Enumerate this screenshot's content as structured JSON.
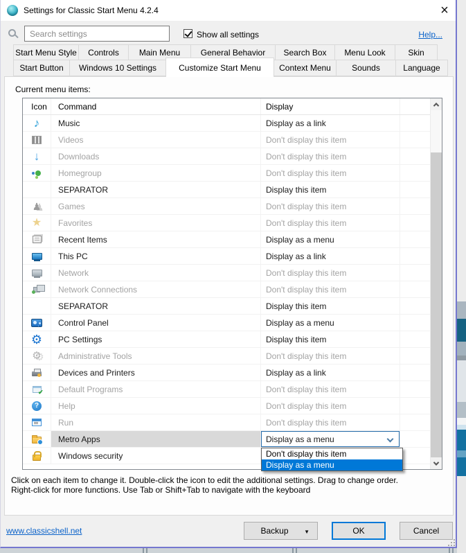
{
  "window": {
    "title": "Settings for Classic Start Menu 4.2.4",
    "app_icon": "classic-shell-logo",
    "close_glyph": "×"
  },
  "search": {
    "placeholder": "Search settings",
    "show_all_label": "Show all settings",
    "show_all_checked": true,
    "help_label": "Help..."
  },
  "tabs": {
    "row1": [
      "Start Menu Style",
      "Controls",
      "Main Menu",
      "General Behavior",
      "Search Box",
      "Menu Look",
      "Skin"
    ],
    "row2": [
      "Start Button",
      "Windows 10 Settings",
      "Customize Start Menu",
      "Context Menu",
      "Sounds",
      "Language"
    ],
    "active": "Customize Start Menu"
  },
  "content": {
    "section_label": "Current menu items:",
    "table": {
      "columns": [
        "Icon",
        "Command",
        "Display"
      ],
      "rows": [
        {
          "icon": "music-icon",
          "command": "Music",
          "display": "Display as a link",
          "muted": false
        },
        {
          "icon": "videos-icon",
          "command": "Videos",
          "display": "Don't display this item",
          "muted": true
        },
        {
          "icon": "downloads-icon",
          "command": "Downloads",
          "display": "Don't display this item",
          "muted": true
        },
        {
          "icon": "homegroup-icon",
          "command": "Homegroup",
          "display": "Don't display this item",
          "muted": true
        },
        {
          "icon": null,
          "command": "SEPARATOR",
          "display": "Display this item",
          "muted": false
        },
        {
          "icon": "games-icon",
          "command": "Games",
          "display": "Don't display this item",
          "muted": true
        },
        {
          "icon": "favorites-icon",
          "command": "Favorites",
          "display": "Don't display this item",
          "muted": true
        },
        {
          "icon": "recent-items-icon",
          "command": "Recent Items",
          "display": "Display as a menu",
          "muted": false
        },
        {
          "icon": "this-pc-icon",
          "command": "This PC",
          "display": "Display as a link",
          "muted": false
        },
        {
          "icon": "network-icon",
          "command": "Network",
          "display": "Don't display this item",
          "muted": true
        },
        {
          "icon": "network-connections-icon",
          "command": "Network Connections",
          "display": "Don't display this item",
          "muted": true
        },
        {
          "icon": null,
          "command": "SEPARATOR",
          "display": "Display this item",
          "muted": false
        },
        {
          "icon": "control-panel-icon",
          "command": "Control Panel",
          "display": "Display as a menu",
          "muted": false
        },
        {
          "icon": "pc-settings-icon",
          "command": "PC Settings",
          "display": "Display this item",
          "muted": false
        },
        {
          "icon": "administrative-tools-icon",
          "command": "Administrative Tools",
          "display": "Don't display this item",
          "muted": true
        },
        {
          "icon": "devices-and-printers-icon",
          "command": "Devices and Printers",
          "display": "Display as a link",
          "muted": false
        },
        {
          "icon": "default-programs-icon",
          "command": "Default Programs",
          "display": "Don't display this item",
          "muted": true
        },
        {
          "icon": "help-icon",
          "command": "Help",
          "display": "Don't display this item",
          "muted": true
        },
        {
          "icon": "run-icon",
          "command": "Run",
          "display": "Don't display this item",
          "muted": true
        },
        {
          "icon": "metro-apps-icon",
          "command": "Metro Apps",
          "display": "Display as a menu",
          "muted": false,
          "selected": true,
          "editing": true
        },
        {
          "icon": "windows-security-icon",
          "command": "Windows security",
          "display": "",
          "muted": false
        }
      ]
    },
    "dropdown": {
      "options": [
        "Don't display this item",
        "Display as a menu"
      ],
      "highlighted_index": 1
    },
    "hint_line1": "Click on each item to change it. Double-click the icon to edit the additional settings. Drag to change order.",
    "hint_line2": "Right-click for more functions. Use Tab or Shift+Tab to navigate with the keyboard"
  },
  "footer": {
    "link": "www.classicshell.net",
    "backup_label": "Backup",
    "ok_label": "OK",
    "cancel_label": "Cancel"
  },
  "colors": {
    "accent_blue": "#0078d7",
    "combo_border_blue": "#2068a8",
    "link_blue": "#0a62c9",
    "muted_text": "#a3a3a3",
    "selected_row_gray": "#d9d9d9",
    "window_border_purple": "#7577cf"
  }
}
